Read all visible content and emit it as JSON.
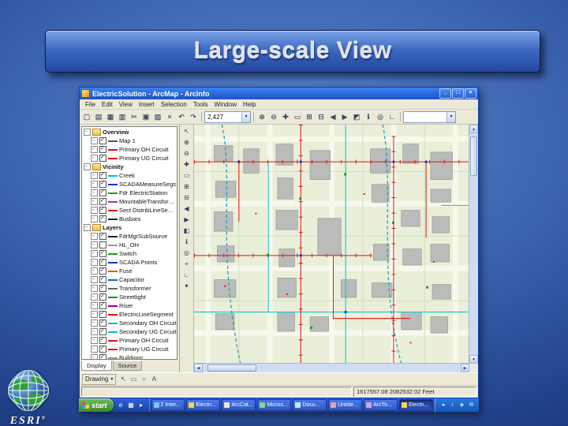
{
  "slide": {
    "title": "Large-scale View"
  },
  "logo": {
    "brand": "ESRI",
    "reg": "®"
  },
  "app": {
    "titlebar": {
      "title": "ElectricSolution - ArcMap - ArcInfo",
      "controls": [
        {
          "name": "minimize-button",
          "glyph": "_"
        },
        {
          "name": "maximize-button",
          "glyph": "□"
        },
        {
          "name": "close-button",
          "glyph": "×"
        }
      ]
    },
    "menu": [
      "File",
      "Edit",
      "View",
      "Insert",
      "Selection",
      "Tools",
      "Window",
      "Help"
    ],
    "toolbar": {
      "std": [
        {
          "name": "new-document-icon",
          "glyph": "▢"
        },
        {
          "name": "open-folder-icon",
          "glyph": "▤"
        },
        {
          "name": "save-icon",
          "glyph": "▦"
        },
        {
          "name": "print-icon",
          "glyph": "▥"
        },
        {
          "name": "cut-icon",
          "glyph": "✂"
        },
        {
          "name": "copy-icon",
          "glyph": "▣"
        },
        {
          "name": "paste-icon",
          "glyph": "▨"
        },
        {
          "name": "delete-icon",
          "glyph": "×"
        },
        {
          "name": "undo-icon",
          "glyph": "↶"
        },
        {
          "name": "redo-icon",
          "glyph": "↷"
        }
      ],
      "scale": "2,427",
      "nav": [
        {
          "name": "zoom-in-icon",
          "glyph": "⊕"
        },
        {
          "name": "zoom-out-icon",
          "glyph": "⊖"
        },
        {
          "name": "pan-icon",
          "glyph": "✚"
        },
        {
          "name": "full-extent-icon",
          "glyph": "▭"
        },
        {
          "name": "fixed-zoom-in-icon",
          "glyph": "⊞"
        },
        {
          "name": "fixed-zoom-out-icon",
          "glyph": "⊟"
        },
        {
          "name": "go-back-icon",
          "glyph": "◀"
        },
        {
          "name": "go-forward-icon",
          "glyph": "▶"
        },
        {
          "name": "select-features-icon",
          "glyph": "◩"
        },
        {
          "name": "identify-icon",
          "glyph": "ℹ"
        },
        {
          "name": "find-icon",
          "glyph": "◎"
        },
        {
          "name": "measure-icon",
          "glyph": "∟"
        }
      ],
      "extra": ""
    },
    "tools": [
      {
        "name": "select-elements-tool",
        "glyph": "↖"
      },
      {
        "name": "zoom-in-tool",
        "glyph": "⊕"
      },
      {
        "name": "zoom-out-tool",
        "glyph": "⊖"
      },
      {
        "name": "pan-tool",
        "glyph": "✚"
      },
      {
        "name": "full-extent-tool",
        "glyph": "▭"
      },
      {
        "name": "fixed-zoom-in-tool",
        "glyph": "⊞"
      },
      {
        "name": "fixed-zoom-out-tool",
        "glyph": "⊟"
      },
      {
        "name": "back-tool",
        "glyph": "◀"
      },
      {
        "name": "forward-tool",
        "glyph": "▶"
      },
      {
        "name": "select-by-rectangle-tool",
        "glyph": "◧"
      },
      {
        "name": "identify-tool",
        "glyph": "ℹ"
      },
      {
        "name": "find-tool",
        "glyph": "◎"
      },
      {
        "name": "goto-xy-tool",
        "glyph": "⌖"
      },
      {
        "name": "measure-tool",
        "glyph": "∟"
      },
      {
        "name": "hyperlink-tool",
        "glyph": "✦"
      }
    ],
    "toc": {
      "tabs": [
        "Display",
        "Source"
      ],
      "items": [
        {
          "type": "frame",
          "level": 0,
          "label": "Overview"
        },
        {
          "type": "layer",
          "level": 1,
          "label": "Map 1",
          "checked": true,
          "color": "#555555"
        },
        {
          "type": "layer",
          "level": 1,
          "label": "Primary OH Circuit",
          "checked": true,
          "color": "#e01010"
        },
        {
          "type": "layer",
          "level": 1,
          "label": "Primary UG Circuit",
          "checked": true,
          "color": "#e01010"
        },
        {
          "type": "frame",
          "level": 0,
          "label": "Vicinity"
        },
        {
          "type": "layer",
          "level": 1,
          "label": "Creek",
          "checked": true,
          "color": "#00b8d8"
        },
        {
          "type": "layer",
          "level": 1,
          "label": "SCADAMeasureSegs",
          "checked": true,
          "color": "#0033cc"
        },
        {
          "type": "layer",
          "level": 1,
          "label": "Fdr ElectricStation",
          "checked": true,
          "color": "#18a018"
        },
        {
          "type": "layer",
          "level": 1,
          "label": "MountableTransformer",
          "checked": true,
          "color": "#884499"
        },
        {
          "type": "layer",
          "level": 1,
          "label": "Sect DistribLineSegme",
          "checked": true,
          "color": "#e01010"
        },
        {
          "type": "layer",
          "level": 1,
          "label": "Busbars",
          "checked": true,
          "color": "#222222"
        },
        {
          "type": "frame",
          "level": 0,
          "label": "Layers"
        },
        {
          "type": "layer",
          "level": 1,
          "label": "FdrMgrSubSource",
          "checked": true,
          "color": "#222222"
        },
        {
          "type": "layer",
          "level": 1,
          "label": "HL_OH",
          "checked": false,
          "color": "#999999"
        },
        {
          "type": "layer",
          "level": 1,
          "label": "Switch",
          "checked": true,
          "color": "#18a018"
        },
        {
          "type": "layer",
          "level": 1,
          "label": "SCADA Points",
          "checked": true,
          "color": "#0033cc"
        },
        {
          "type": "layer",
          "level": 1,
          "label": "Fuse",
          "checked": true,
          "color": "#cc6600"
        },
        {
          "type": "layer",
          "level": 1,
          "label": "Capacitor",
          "checked": true,
          "color": "#0066cc"
        },
        {
          "type": "layer",
          "level": 1,
          "label": "Transformer",
          "checked": true,
          "color": "#666666"
        },
        {
          "type": "layer",
          "level": 1,
          "label": "Streetlight",
          "checked": true,
          "color": "#009900"
        },
        {
          "type": "layer",
          "level": 1,
          "label": "Riser",
          "checked": true,
          "color": "#990099"
        },
        {
          "type": "layer",
          "level": 1,
          "label": "ElectricLineSegment",
          "checked": true,
          "color": "#e01010"
        },
        {
          "type": "layer",
          "level": 1,
          "label": "Secondary OH Circuit",
          "checked": true,
          "color": "#00b8d8"
        },
        {
          "type": "layer",
          "level": 1,
          "label": "Secondary UG Circuit",
          "checked": true,
          "color": "#00b8d8"
        },
        {
          "type": "layer",
          "level": 1,
          "label": "Primary OH Circuit",
          "checked": true,
          "color": "#e01010"
        },
        {
          "type": "layer",
          "level": 1,
          "label": "Primary UG Circuit",
          "checked": true,
          "color": "#e01010"
        },
        {
          "type": "layer",
          "level": 1,
          "label": "Buildings",
          "checked": true,
          "color": "#999999"
        }
      ]
    },
    "drawing": {
      "label": "Drawing",
      "icons": [
        {
          "name": "pointer-icon",
          "glyph": "↖"
        },
        {
          "name": "rectangle-icon",
          "glyph": "▭"
        },
        {
          "name": "circle-icon",
          "glyph": "○"
        },
        {
          "name": "text-icon",
          "glyph": "A"
        }
      ]
    },
    "status": {
      "coords": "1617557.08 2082532.02 Feet"
    }
  },
  "taskbar": {
    "start": "start",
    "quick": [
      {
        "name": "internet-explorer-icon",
        "glyph": "e"
      },
      {
        "name": "show-desktop-icon",
        "glyph": "▦"
      },
      {
        "name": "media-player-icon",
        "glyph": "▸"
      }
    ],
    "buttons": [
      {
        "label": "2 Inter...",
        "icon": "#7ec3f0"
      },
      {
        "label": "Electric...",
        "icon": "#ffd24d"
      },
      {
        "label": "ArcCat...",
        "icon": "#f0e6c8"
      },
      {
        "label": "Micros...",
        "icon": "#8fd08f"
      },
      {
        "label": "Docum...",
        "icon": "#cfe2ff"
      },
      {
        "label": "Untitle...",
        "icon": "#e8a0a0"
      },
      {
        "label": "ArcTo...",
        "icon": "#d0a0e0"
      },
      {
        "label": "Electri...",
        "icon": "#ffd24d",
        "active": true
      }
    ],
    "tray": [
      {
        "name": "volume-icon",
        "glyph": "◂"
      },
      {
        "name": "network-icon",
        "glyph": "↕"
      },
      {
        "name": "antivirus-icon",
        "glyph": "◈"
      },
      {
        "name": "mail-icon",
        "glyph": "✉"
      }
    ]
  }
}
